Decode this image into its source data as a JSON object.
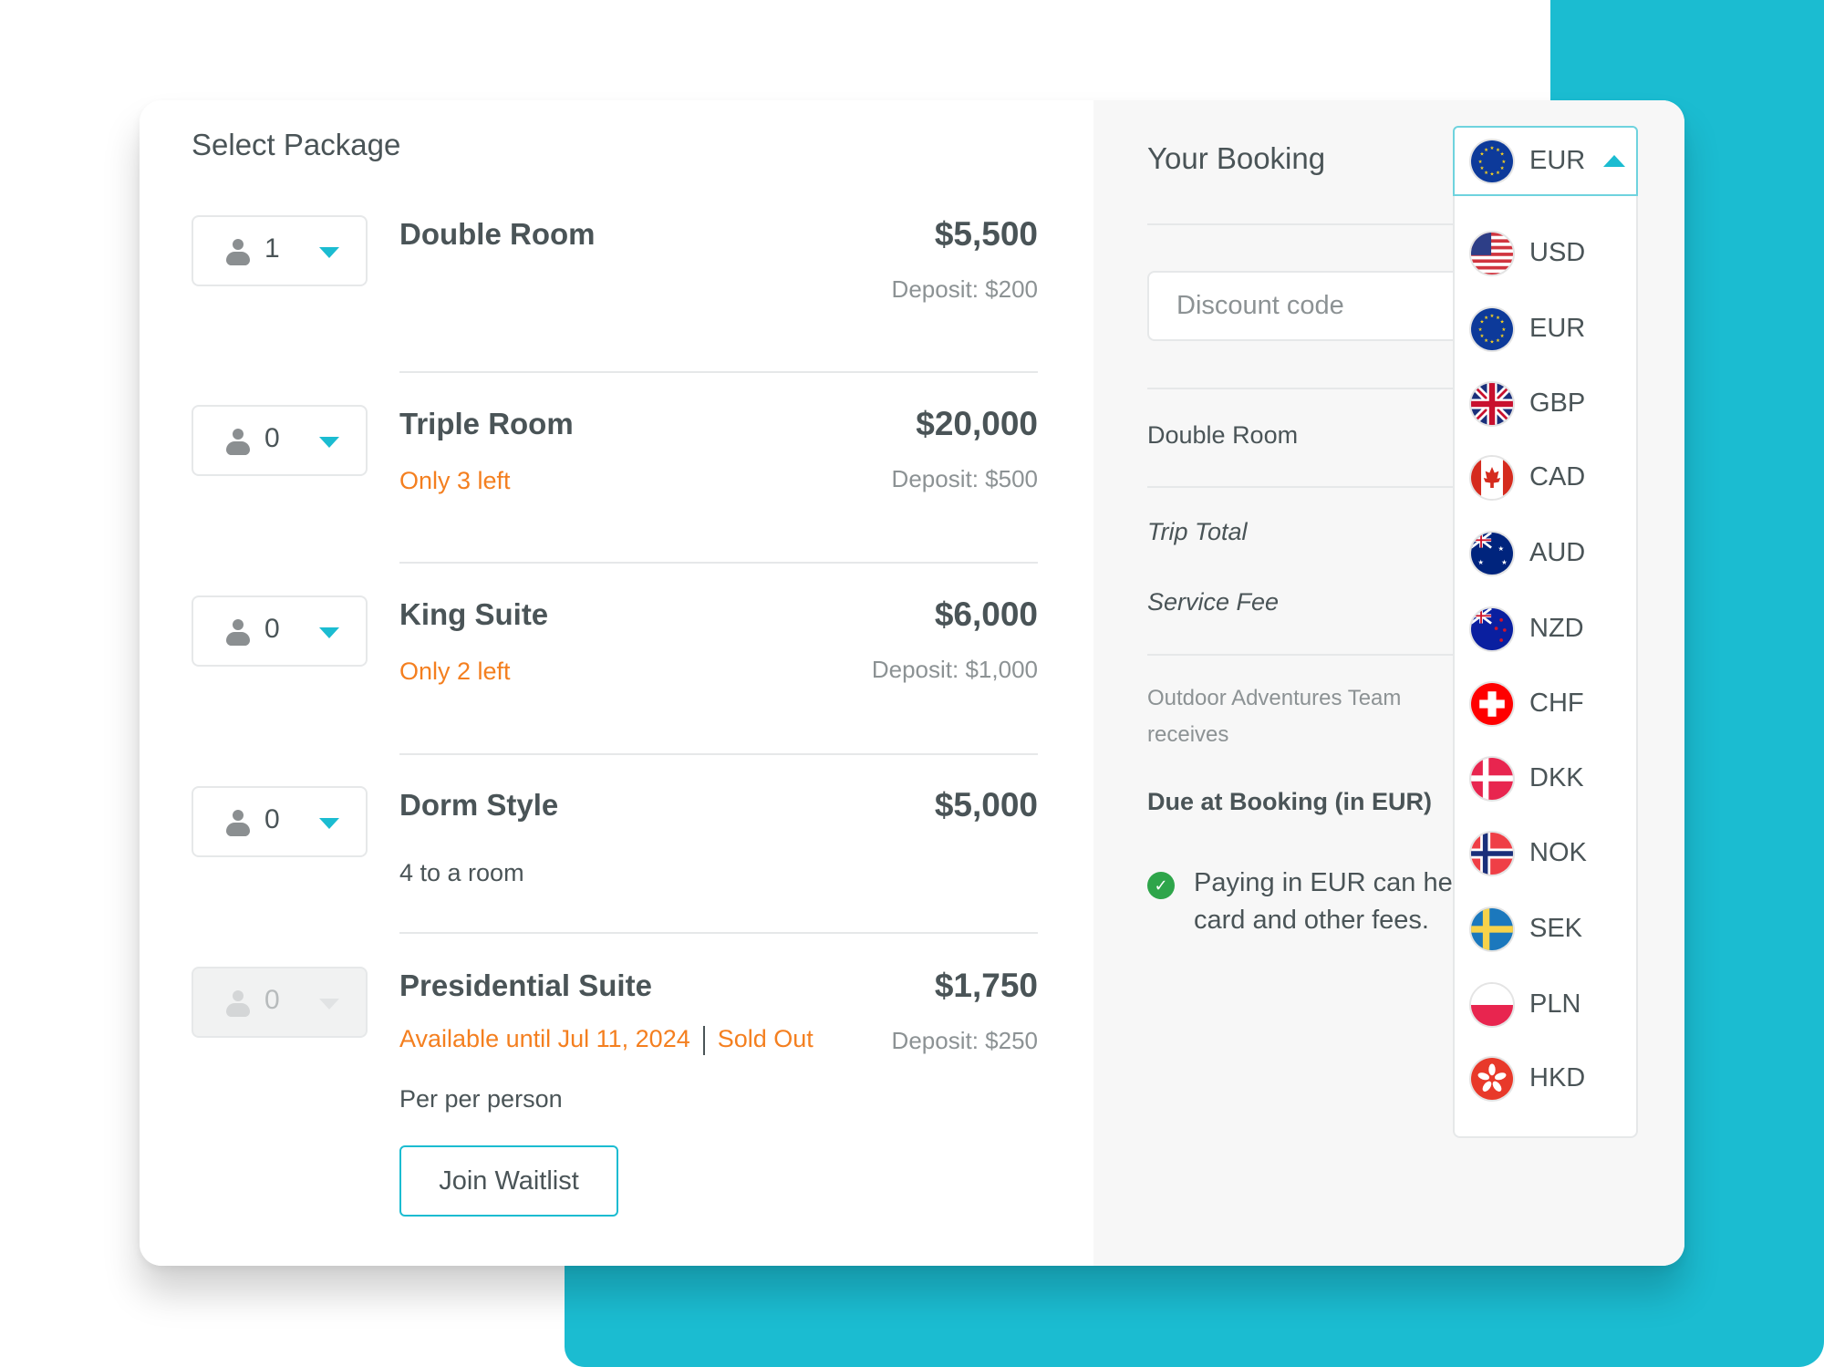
{
  "select_package": {
    "title": "Select Package",
    "packages": [
      {
        "name": "Double Room",
        "quantity": "1",
        "price": "$5,500",
        "deposit": "Deposit: $200",
        "note": "",
        "sub": "",
        "disabled": false
      },
      {
        "name": "Triple Room",
        "quantity": "0",
        "price": "$20,000",
        "deposit": "Deposit: $500",
        "note": "Only 3 left",
        "sub": "",
        "disabled": false
      },
      {
        "name": "King Suite",
        "quantity": "0",
        "price": "$6,000",
        "deposit": "Deposit: $1,000",
        "note": "Only 2 left",
        "sub": "",
        "disabled": false
      },
      {
        "name": "Dorm Style",
        "quantity": "0",
        "price": "$5,000",
        "deposit": "",
        "note": "",
        "sub": "4 to a room",
        "disabled": false
      },
      {
        "name": "Presidential Suite",
        "quantity": "0",
        "price": "$1,750",
        "deposit": "Deposit: $250",
        "availability": "Available until Jul 11, 2024",
        "status": "Sold Out",
        "sub": "Per per person",
        "disabled": true,
        "action_label": "Join Waitlist"
      }
    ]
  },
  "booking": {
    "title": "Your Booking",
    "discount_placeholder": "Discount code",
    "line_item": "Double Room",
    "trip_total_label": "Trip Total",
    "service_fee_label": "Service Fee",
    "receives_label": "Outdoor Adventures Team receives",
    "due_label": "Due at Booking (in EUR)",
    "info_line1": "Paying in EUR can he",
    "info_line2": "card and other fees."
  },
  "currency": {
    "selected": "EUR",
    "expanded": true,
    "options": [
      "USD",
      "EUR",
      "GBP",
      "CAD",
      "AUD",
      "NZD",
      "CHF",
      "DKK",
      "NOK",
      "SEK",
      "PLN",
      "HKD"
    ]
  },
  "colors": {
    "accent": "#1bbcd1",
    "warning": "#f47f1f",
    "success": "#2ea54a",
    "text": "#4a5457",
    "muted": "#8c9294"
  }
}
